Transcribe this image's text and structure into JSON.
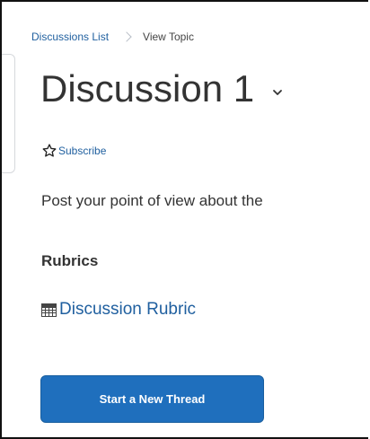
{
  "breadcrumb": {
    "items": [
      {
        "label": "Discussions List"
      },
      {
        "label": "View Topic"
      }
    ]
  },
  "topic": {
    "title": "Discussion 1",
    "subscribe_label": "Subscribe",
    "description": "Post your point of view about the"
  },
  "rubrics": {
    "heading": "Rubrics",
    "link_label": "Discussion Rubric"
  },
  "actions": {
    "start_thread_label": "Start a New Thread"
  },
  "icons": {
    "chevron": "chevron-down-icon",
    "subscribe": "star-outline-icon",
    "rubric": "grid-table-icon"
  },
  "colors": {
    "link": "#1f5f9f",
    "primary_button": "#1f6fbd",
    "text": "#333333"
  }
}
